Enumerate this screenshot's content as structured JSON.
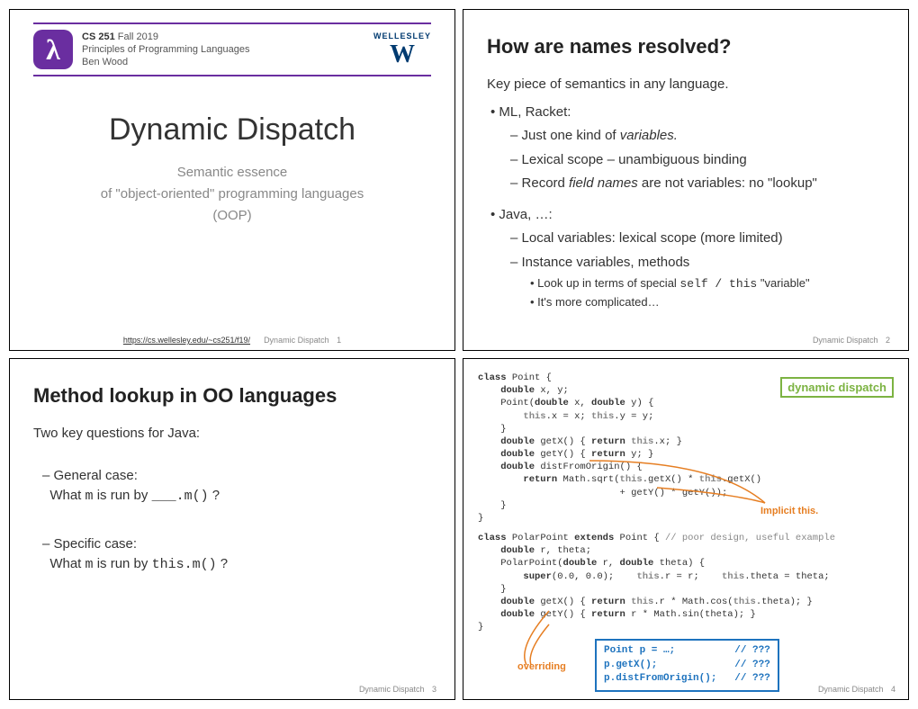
{
  "slide1": {
    "course_code": "CS 251",
    "term": " Fall 2019",
    "course_title": "Principles of Programming Languages",
    "instructor": "Ben Wood",
    "logo_top": "WELLESLEY",
    "logo_w": "W",
    "title": "Dynamic Dispatch",
    "sub1": "Semantic essence",
    "sub2": "of \"object-oriented\" programming languages",
    "sub3": "(OOP)",
    "url": "https://cs.wellesley.edu/~cs251/f19/",
    "footer_label": "Dynamic Dispatch",
    "page": "1"
  },
  "slide2": {
    "title": "How are names resolved?",
    "intro": "Key piece of semantics in any language.",
    "b1": "ML, Racket:",
    "b1d1a": "Just one kind of ",
    "b1d1b": "variables.",
    "b1d2": "Lexical scope – unambiguous binding",
    "b1d3a": "Record ",
    "b1d3b": "field names",
    "b1d3c": " are not variables: no \"lookup\"",
    "b2": "Java, …:",
    "b2d1": "Local variables: lexical scope (more limited)",
    "b2d2": "Instance variables, methods",
    "b2s1a": "Look up in terms of special ",
    "b2s1b": "self / this",
    "b2s1c": " \"variable\"",
    "b2s2": "It's more complicated…",
    "footer_label": "Dynamic Dispatch",
    "page": "2"
  },
  "slide3": {
    "title": "Method lookup in OO languages",
    "intro": "Two key questions for Java:",
    "d1a": "General case:",
    "d1b_pre": "What ",
    "d1b_m": "m",
    "d1b_mid": " is run by ",
    "d1b_code": "___.m()",
    "d1b_post": " ?",
    "d2a": "Specific case:",
    "d2b_pre": "What ",
    "d2b_m": "m",
    "d2b_mid": " is run by ",
    "d2b_code": "this.m()",
    "d2b_post": " ?",
    "footer_label": "Dynamic Dispatch",
    "page": "3"
  },
  "slide4": {
    "badge": "dynamic dispatch",
    "implicit": "Implicit this.",
    "overriding": "overriding",
    "code1_l1a": "class",
    "code1_l1b": " Point {",
    "code1_l2a": "    double",
    "code1_l2b": " x, y;",
    "code1_l3a": "    Point(",
    "code1_l3b": "double",
    "code1_l3c": " x, ",
    "code1_l3d": "double",
    "code1_l3e": " y) {",
    "code1_l4a": "        this",
    "code1_l4b": ".x = x; ",
    "code1_l4c": "this",
    "code1_l4d": ".y = y;",
    "code1_l5": "    }",
    "code1_l6a": "    double",
    "code1_l6b": " getX() { ",
    "code1_l6c": "return",
    "code1_l6d": " ",
    "code1_l6e": "this",
    "code1_l6f": ".x; }",
    "code1_l7a": "    double",
    "code1_l7b": " getY() { ",
    "code1_l7c": "return",
    "code1_l7d": " y; }",
    "code1_l8a": "    double",
    "code1_l8b": " distFromOrigin() {",
    "code1_l9a": "        return",
    "code1_l9b": " Math.sqrt(",
    "code1_l9c": "this",
    "code1_l9d": ".getX() * ",
    "code1_l9e": "this",
    "code1_l9f": ".getX()",
    "code1_l10": "                         + getY() * getY());",
    "code1_l11": "    }",
    "code1_l12": "}",
    "code2_l1a": "class",
    "code2_l1b": " PolarPoint ",
    "code2_l1c": "extends",
    "code2_l1d": " Point { ",
    "code2_l1e": "// poor design, useful example",
    "code2_l2a": "    double",
    "code2_l2b": " r, theta;",
    "code2_l3a": "    PolarPoint(",
    "code2_l3b": "double",
    "code2_l3c": " r, ",
    "code2_l3d": "double",
    "code2_l3e": " theta) {",
    "code2_l4a": "        super",
    "code2_l4b": "(0.0, 0.0);    ",
    "code2_l4c": "this",
    "code2_l4d": ".r = r;    ",
    "code2_l4e": "this",
    "code2_l4f": ".theta = theta;",
    "code2_l5": "    }",
    "code2_l6a": "    double",
    "code2_l6b": " getX() { ",
    "code2_l6c": "return",
    "code2_l6d": " ",
    "code2_l6e": "this",
    "code2_l6f": ".r * Math.cos(",
    "code2_l6g": "this",
    "code2_l6h": ".theta); }",
    "code2_l7a": "    double",
    "code2_l7b": " getY() { ",
    "code2_l7c": "return",
    "code2_l7d": " r * Math.sin(theta); }",
    "code2_l8": "}",
    "box_l1": "Point p = …;          // ???",
    "box_l2": "p.getX();             // ???",
    "box_l3": "p.distFromOrigin();   // ???",
    "footer_label": "Dynamic Dispatch",
    "page": "4"
  }
}
